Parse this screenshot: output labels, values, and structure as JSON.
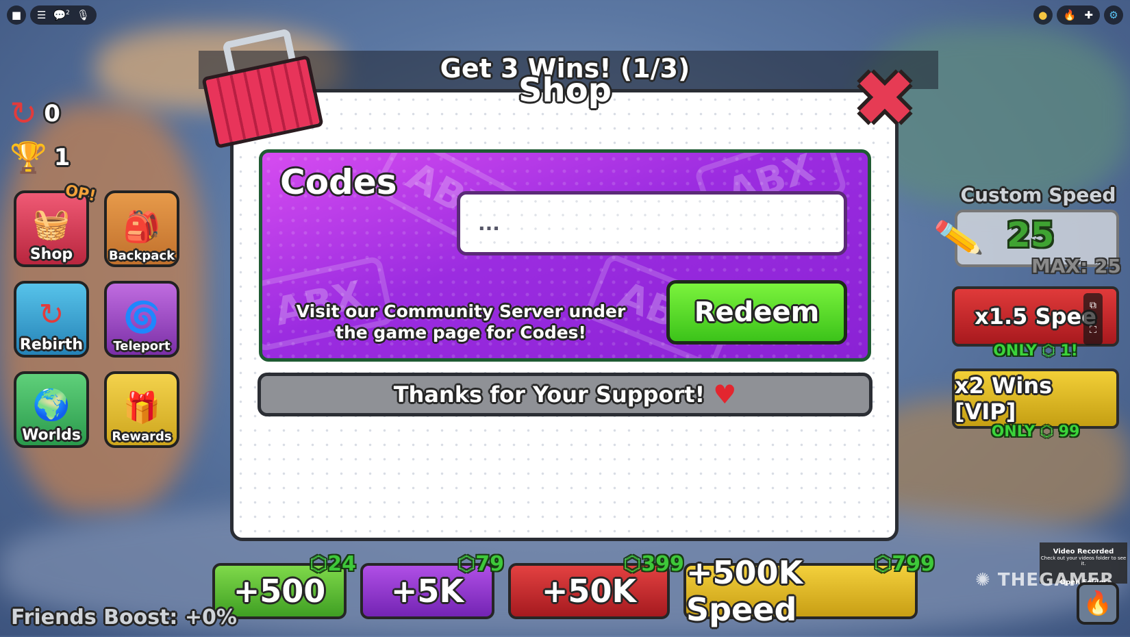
{
  "topbar": {
    "chat_badge": "2"
  },
  "stats": {
    "rebirths": "0",
    "wins": "1"
  },
  "menu": {
    "shop": "Shop",
    "op_badge": "OP!",
    "backpack": "Backpack",
    "rebirth": "Rebirth",
    "teleport": "Teleport",
    "worlds": "Worlds",
    "rewards": "Rewards"
  },
  "goal": "Get 3 Wins! (1/3)",
  "shop": {
    "title": "Shop",
    "codes_label": "Codes",
    "code_placeholder": "...",
    "watermark": "ABX",
    "visit_text": "Visit our Community Server under the game page for Codes!",
    "redeem_label": "Redeem",
    "support_text": "Thanks for Your Support!"
  },
  "right_panel": {
    "custom_speed_title": "Custom Speed",
    "speed_value": "25",
    "max_label": "MAX: 25",
    "gamepasses": [
      {
        "label": "x1.5 Spee",
        "price": "ONLY ⬡ 1!"
      },
      {
        "label": "x2 Wins [VIP]",
        "price": "ONLY ⬡ 99"
      }
    ]
  },
  "bottom_packs": [
    {
      "label": "+500",
      "price": "⬡24"
    },
    {
      "label": "+5K",
      "price": "⬡79"
    },
    {
      "label": "+50K",
      "price": "⬡399"
    },
    {
      "label": "+500K Speed",
      "price": "⬡799"
    }
  ],
  "friends_boost": "Friends Boost: +0%",
  "video_toast": {
    "title": "Video Recorded",
    "sub": "Check out your videos folder to see it.",
    "action": "Open Folder"
  },
  "brand": "THEGAMER",
  "colors": {
    "codes_purple": "#9b2ce0",
    "redeem_green": "#3cc31a",
    "close_red": "#e63b54",
    "robux_green": "#3ec83a"
  }
}
